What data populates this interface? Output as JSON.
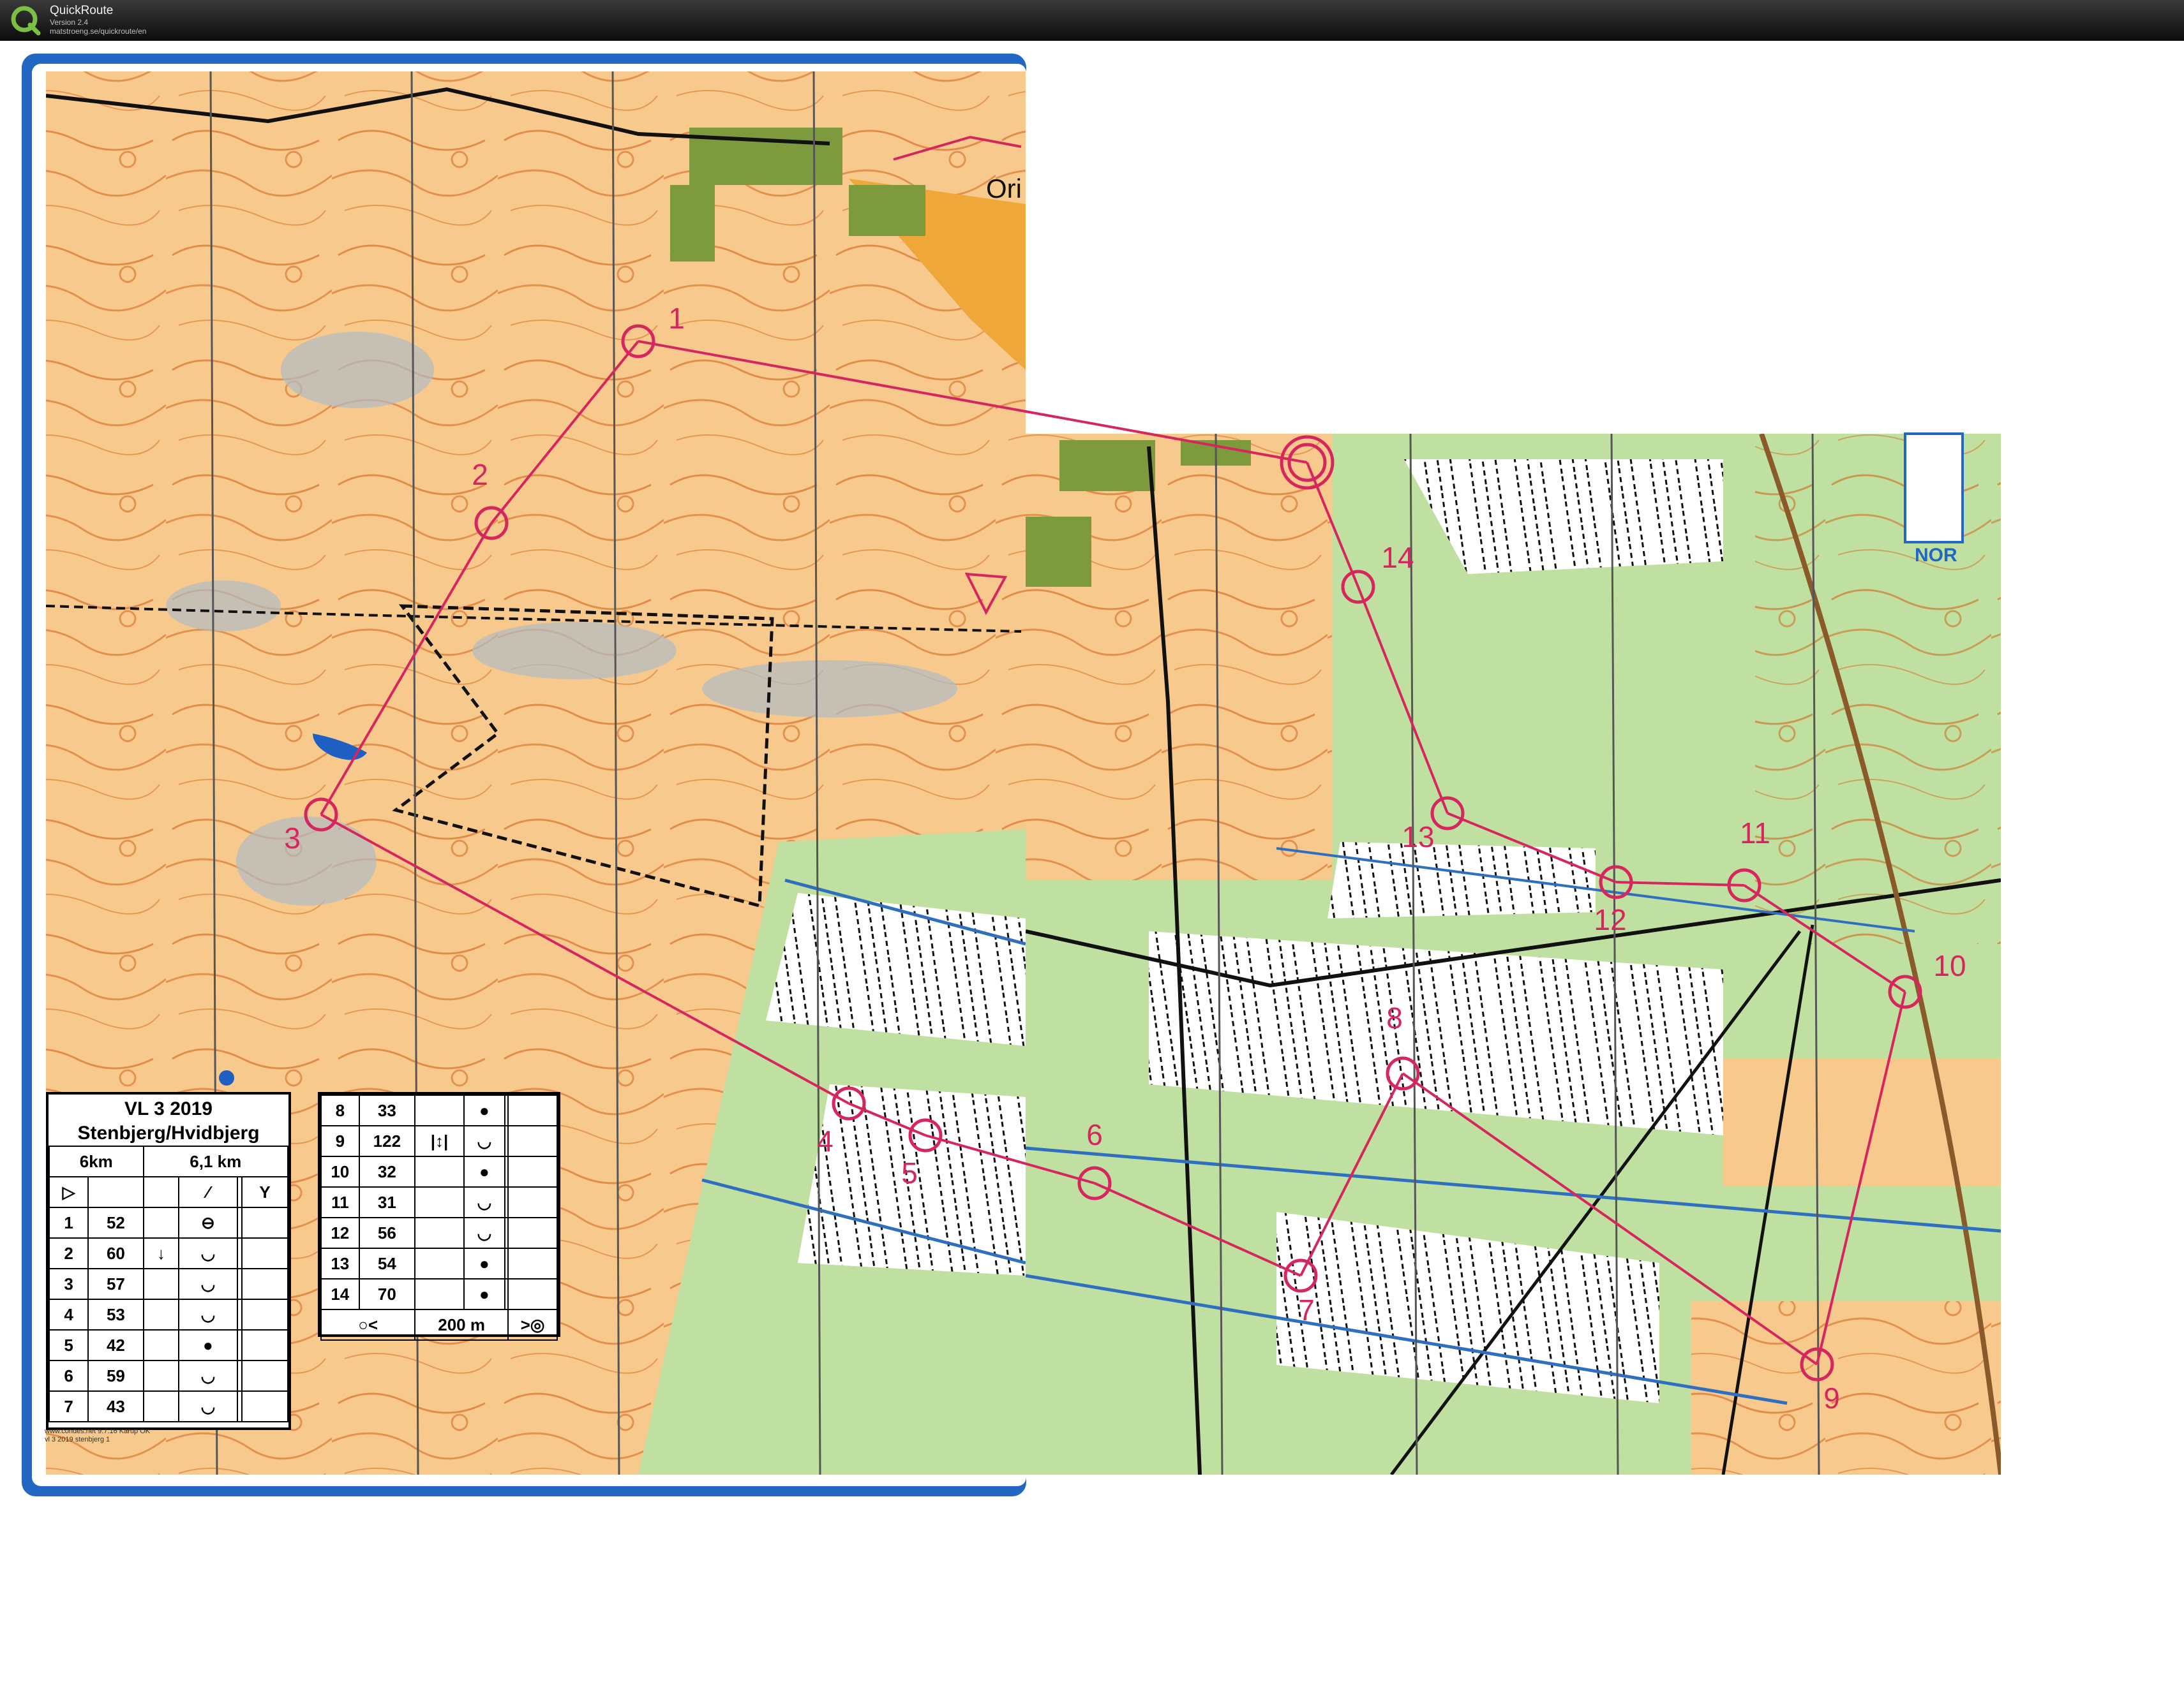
{
  "app": {
    "title": "QuickRoute",
    "version": "Version 2.4",
    "url": "matstroeng.se/quickroute/en"
  },
  "map": {
    "header_text": "Ori",
    "header_text_right": "NOR",
    "controls": [
      {
        "label": "1"
      },
      {
        "label": "2"
      },
      {
        "label": "3"
      },
      {
        "label": "4"
      },
      {
        "label": "5"
      },
      {
        "label": "6"
      },
      {
        "label": "7"
      },
      {
        "label": "8"
      },
      {
        "label": "9"
      },
      {
        "label": "10"
      },
      {
        "label": "11"
      },
      {
        "label": "12"
      },
      {
        "label": "13"
      },
      {
        "label": "14"
      }
    ],
    "colors": {
      "course": "#d6265e",
      "terrain": "#f7c98d",
      "forest": "#b6de95",
      "water": "#2f6fc0",
      "contour": "#d05a10",
      "border": "#2367c4"
    }
  },
  "legend": {
    "event": "VL 3 2019",
    "area": "Stenbjerg/Hvidbjerg",
    "course": "6km",
    "length": "6,1 km",
    "rows_left": [
      {
        "num": "1",
        "code": "52",
        "dir": "",
        "feature": "⊖"
      },
      {
        "num": "2",
        "code": "60",
        "dir": "↓",
        "feature": "◡"
      },
      {
        "num": "3",
        "code": "57",
        "dir": "",
        "feature": "◡"
      },
      {
        "num": "4",
        "code": "53",
        "dir": "",
        "feature": "◡"
      },
      {
        "num": "5",
        "code": "42",
        "dir": "",
        "feature": "●"
      },
      {
        "num": "6",
        "code": "59",
        "dir": "",
        "feature": "◡"
      },
      {
        "num": "7",
        "code": "43",
        "dir": "",
        "feature": "◡"
      }
    ],
    "rows_right": [
      {
        "num": "8",
        "code": "33",
        "dir": "",
        "feature": "●"
      },
      {
        "num": "9",
        "code": "122",
        "dir": "|↕|",
        "feature": "◡"
      },
      {
        "num": "10",
        "code": "32",
        "dir": "",
        "feature": "●"
      },
      {
        "num": "11",
        "code": "31",
        "dir": "",
        "feature": "◡"
      },
      {
        "num": "12",
        "code": "56",
        "dir": "",
        "feature": "◡"
      },
      {
        "num": "13",
        "code": "54",
        "dir": "",
        "feature": "●"
      },
      {
        "num": "14",
        "code": "70",
        "dir": "",
        "feature": "●"
      }
    ],
    "finish_text": "200 m",
    "credit_1": "www.condes.net 9.7.16 Karup OK",
    "credit_2": "vl 3 2019 stenbjerg 1"
  }
}
